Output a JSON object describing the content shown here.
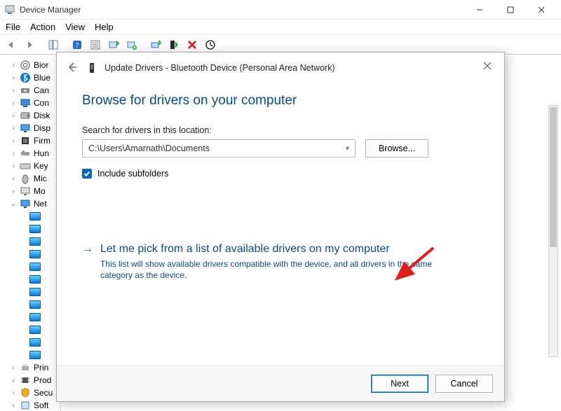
{
  "window": {
    "title": "Device Manager",
    "menus": [
      "File",
      "Action",
      "View",
      "Help"
    ]
  },
  "tree": {
    "items": [
      {
        "label": "Bior",
        "icon": "biometric"
      },
      {
        "label": "Blue",
        "icon": "bluetooth"
      },
      {
        "label": "Can",
        "icon": "camera"
      },
      {
        "label": "Con",
        "icon": "computer"
      },
      {
        "label": "Disk",
        "icon": "disk"
      },
      {
        "label": "Disp",
        "icon": "display"
      },
      {
        "label": "Firm",
        "icon": "firmware"
      },
      {
        "label": "Hun",
        "icon": "hid"
      },
      {
        "label": "Key",
        "icon": "keyboard"
      },
      {
        "label": "Mic",
        "icon": "mouse"
      },
      {
        "label": "Mo",
        "icon": "monitor"
      },
      {
        "label": "Net",
        "icon": "network",
        "expanded": true,
        "children_count": 12
      },
      {
        "label": "Prin",
        "icon": "print"
      },
      {
        "label": "Prod",
        "icon": "processor"
      },
      {
        "label": "Secu",
        "icon": "security"
      },
      {
        "label": "Soft",
        "icon": "software"
      }
    ]
  },
  "dialog": {
    "header_title": "Update Drivers - Bluetooth Device (Personal Area Network)",
    "heading": "Browse for drivers on your computer",
    "search_label": "Search for drivers in this location:",
    "path_value": "C:\\Users\\Amarnath\\Documents",
    "browse_label": "Browse...",
    "include_subfolders_label": "Include subfolders",
    "include_subfolders_checked": true,
    "pick_title": "Let me pick from a list of available drivers on my computer",
    "pick_desc": "This list will show available drivers compatible with the device, and all drivers in the same category as the device.",
    "next_label": "Next",
    "cancel_label": "Cancel"
  }
}
